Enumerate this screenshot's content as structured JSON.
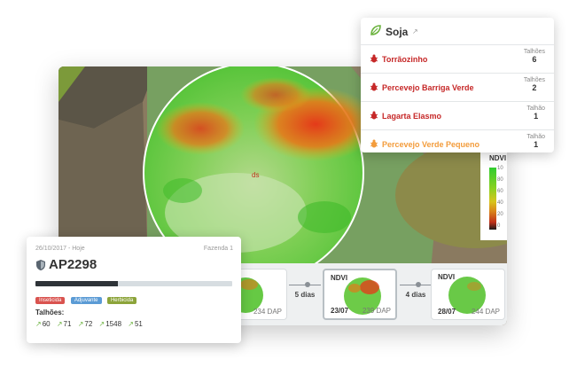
{
  "map": {
    "marker_label": "ds"
  },
  "legend": {
    "title": "NDVI",
    "ticks": [
      "10",
      "80",
      "60",
      "40",
      "20",
      "0"
    ]
  },
  "timeline": {
    "thumbnails": [
      {
        "label": "",
        "date": "",
        "dap": "234 DAP"
      },
      {
        "label": "NDVI",
        "date": "23/07",
        "dap": "239 DAP"
      },
      {
        "label": "NDVI",
        "date": "28/07",
        "dap": "244 DAP"
      }
    ],
    "gaps": [
      "5 dias",
      "4 dias"
    ]
  },
  "soja_card": {
    "title": "Soja",
    "icon": "leaf-icon",
    "pests": [
      {
        "name": "Torrãozinho",
        "count_label": "Talhões",
        "count": "6",
        "color": "#c62828"
      },
      {
        "name": "Percevejo Barriga Verde",
        "count_label": "Talhões",
        "count": "2",
        "color": "#c62828"
      },
      {
        "name": "Lagarta Elasmo",
        "count_label": "Talhão",
        "count": "1",
        "color": "#c62828"
      },
      {
        "name": "Percevejo Verde Pequeno",
        "count_label": "Talhão",
        "count": "1",
        "color": "#f39c3c"
      }
    ]
  },
  "ap_card": {
    "date": "26/10/2017 - Hoje",
    "farm": "Fazenda 1",
    "name": "AP2298",
    "progress": 0.42,
    "tags": [
      {
        "label": "Inseticida",
        "color": "#d9534f"
      },
      {
        "label": "Adjuvante",
        "color": "#5b9bd5"
      },
      {
        "label": "Herbicida",
        "color": "#8ca43a"
      }
    ],
    "plots_label": "Talhões:",
    "plots": [
      "60",
      "71",
      "72",
      "1548",
      "51"
    ]
  }
}
